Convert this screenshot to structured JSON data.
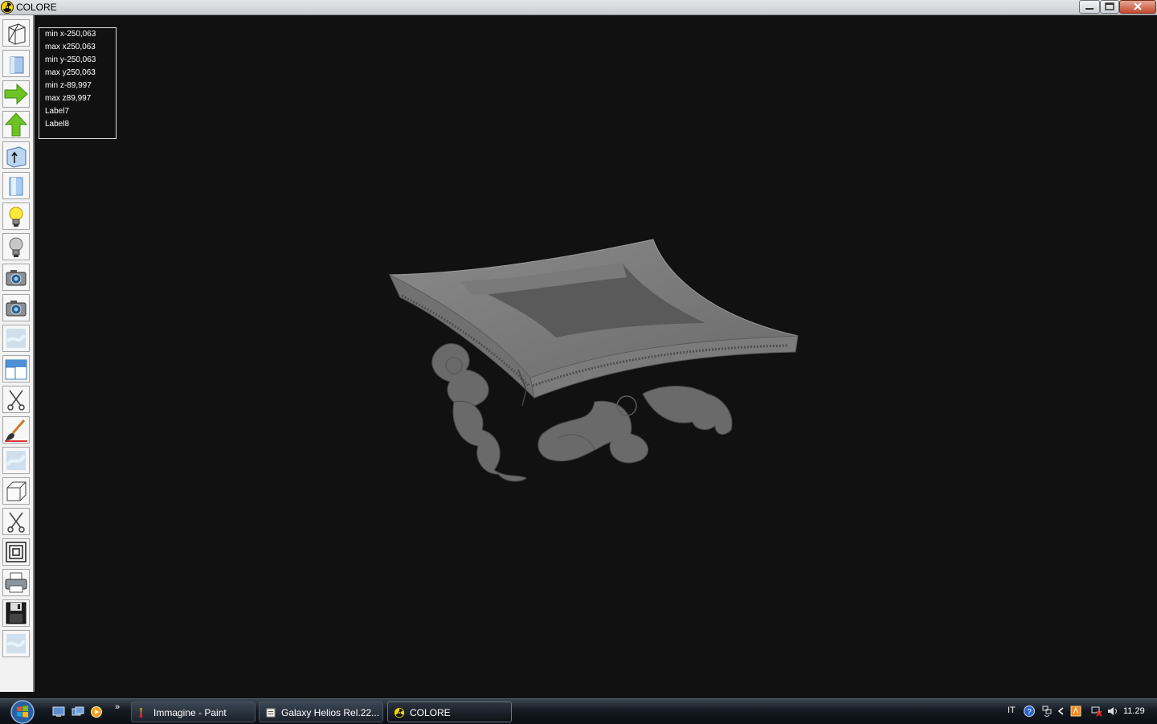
{
  "window": {
    "title": "COLORE",
    "title_icon": "radiation-icon",
    "controls": [
      "minimize-icon",
      "maximize-icon",
      "close-icon"
    ]
  },
  "toolbar": {
    "tools": [
      "wireframe-box-icon",
      "solid-box-icon",
      "arrow-right-icon",
      "arrow-up-icon",
      "box-axis-icon",
      "cylinder-icon",
      "lightbulb-on-icon",
      "lightbulb-off-icon",
      "camera-icon",
      "camera-alt-icon",
      "texture-icon",
      "window-layout-icon",
      "scissors-icon",
      "brush-icon",
      "texture-alt-icon",
      "cube-icon",
      "scissors-alt-icon",
      "nested-squares-icon",
      "printer-icon",
      "floppy-disk-icon",
      "texture-third-icon"
    ]
  },
  "info_panel": {
    "lines": [
      "min x-250,063",
      "max x250,063",
      "min y-250,063",
      "max y250,063",
      "min z-89,997",
      "max z89,997",
      "Label7",
      "Label8"
    ]
  },
  "viewport": {
    "background": "#111111",
    "model_color": "#6e6e6e"
  },
  "taskbar": {
    "quick_launch": [
      "show-desktop-icon",
      "switch-windows-icon",
      "media-player-icon"
    ],
    "more": "»",
    "tasks": [
      {
        "label": "Immagine - Paint",
        "icon": "paint-icon",
        "active": false
      },
      {
        "label": "Galaxy Helios  Rel.22...",
        "icon": "document-icon",
        "active": false
      },
      {
        "label": "COLORE",
        "icon": "radiation-icon",
        "active": true
      }
    ],
    "tray": {
      "language": "IT",
      "icons": [
        "help-icon",
        "network-icon",
        "chevron-left-icon",
        "app-tray-icon",
        "network-error-icon",
        "volume-icon"
      ],
      "clock": "11.29"
    }
  }
}
